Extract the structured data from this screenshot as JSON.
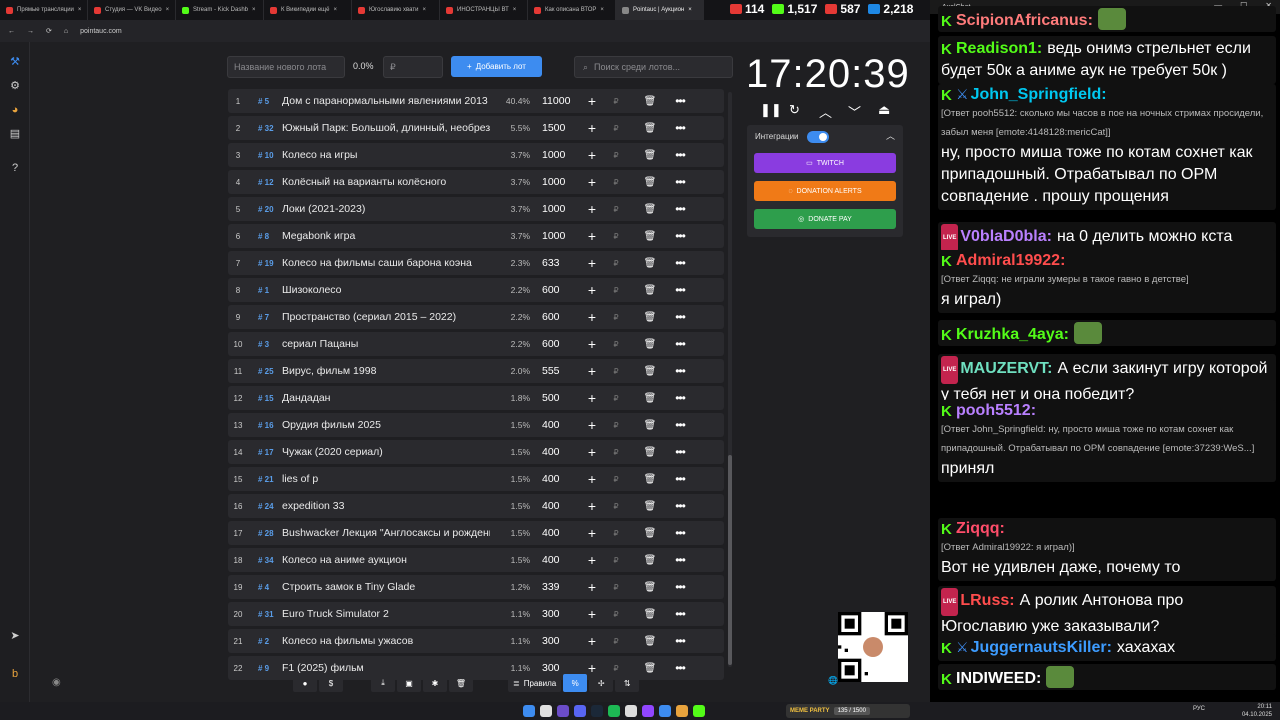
{
  "browser": {
    "tabs": [
      {
        "label": "Прямые трансляции",
        "color": "#e53935"
      },
      {
        "label": "Студия — VK Видео",
        "color": "#e53935"
      },
      {
        "label": "Stream - Kick Dashb",
        "color": "#53fc18"
      },
      {
        "label": "К Википедии ещё",
        "color": "#e53935"
      },
      {
        "label": "Югославию хвати",
        "color": "#e53935"
      },
      {
        "label": "ИНОСТРАНЦЫ ВТ",
        "color": "#e53935"
      },
      {
        "label": "Как описана ВТОР",
        "color": "#e53935"
      },
      {
        "label": "Pointauc | Аукцион",
        "color": "#888888",
        "active": true
      }
    ],
    "url": "pointauc.com"
  },
  "stream_stats": [
    {
      "value": "114",
      "color": "#e53935"
    },
    {
      "value": "1,517",
      "color": "#53fc18"
    },
    {
      "value": "587",
      "color": "#e53935"
    },
    {
      "value": "2,218",
      "color": "#1e88e5"
    }
  ],
  "controls": {
    "lot_name_placeholder": "Название нового лота",
    "percent": "0.0%",
    "amount_placeholder": "₽",
    "add_button": "Добавить лот",
    "search_placeholder": "Поиск среди лотов..."
  },
  "lots": [
    {
      "idx": "1",
      "id": "# 5",
      "name": "Дом с паранормальными явлениями 2013",
      "pct": "40.4%",
      "amount": "11000"
    },
    {
      "idx": "2",
      "id": "# 32",
      "name": "Южный Парк: Большой, длинный, необрезанный",
      "pct": "5.5%",
      "amount": "1500"
    },
    {
      "idx": "3",
      "id": "# 10",
      "name": "Колесо на игры",
      "pct": "3.7%",
      "amount": "1000"
    },
    {
      "idx": "4",
      "id": "# 12",
      "name": "Колёсный на варианты колёсного",
      "pct": "3.7%",
      "amount": "1000"
    },
    {
      "idx": "5",
      "id": "# 20",
      "name": "Локи (2021-2023)",
      "pct": "3.7%",
      "amount": "1000"
    },
    {
      "idx": "6",
      "id": "# 8",
      "name": "Megabonk игра",
      "pct": "3.7%",
      "amount": "1000"
    },
    {
      "idx": "7",
      "id": "# 19",
      "name": "Колесо на фильмы саши барона коэна",
      "pct": "2.3%",
      "amount": "633"
    },
    {
      "idx": "8",
      "id": "# 1",
      "name": "Шизоколесо",
      "pct": "2.2%",
      "amount": "600"
    },
    {
      "idx": "9",
      "id": "# 7",
      "name": "Пространство (сериал 2015 – 2022)",
      "pct": "2.2%",
      "amount": "600"
    },
    {
      "idx": "10",
      "id": "# 3",
      "name": "сериал Пацаны",
      "pct": "2.2%",
      "amount": "600"
    },
    {
      "idx": "11",
      "id": "# 25",
      "name": "Вирус, фильм 1998",
      "pct": "2.0%",
      "amount": "555"
    },
    {
      "idx": "12",
      "id": "# 15",
      "name": "Дандадан",
      "pct": "1.8%",
      "amount": "500"
    },
    {
      "idx": "13",
      "id": "# 16",
      "name": "Орудия фильм 2025",
      "pct": "1.5%",
      "amount": "400"
    },
    {
      "idx": "14",
      "id": "# 17",
      "name": "Чужак (2020 сериал)",
      "pct": "1.5%",
      "amount": "400"
    },
    {
      "idx": "15",
      "id": "# 21",
      "name": "lies of p",
      "pct": "1.5%",
      "amount": "400"
    },
    {
      "idx": "16",
      "id": "# 24",
      "name": "expedition 33",
      "pct": "1.5%",
      "amount": "400"
    },
    {
      "idx": "17",
      "id": "# 28",
      "name": "Bushwacker Лекция \"Англосаксы и рождение",
      "pct": "1.5%",
      "amount": "400"
    },
    {
      "idx": "18",
      "id": "# 34",
      "name": "Колесо на аниме аукцион",
      "pct": "1.5%",
      "amount": "400"
    },
    {
      "idx": "19",
      "id": "# 4",
      "name": "Строить замок в Tiny Glade",
      "pct": "1.2%",
      "amount": "339"
    },
    {
      "idx": "20",
      "id": "# 31",
      "name": "Euro Truck Simulator 2",
      "pct": "1.1%",
      "amount": "300"
    },
    {
      "idx": "21",
      "id": "# 2",
      "name": "Колесо на фильмы ужасов",
      "pct": "1.1%",
      "amount": "300"
    },
    {
      "idx": "22",
      "id": "# 9",
      "name": "F1 (2025) фильм",
      "pct": "1.1%",
      "amount": "300"
    }
  ],
  "timer": "17:20:39",
  "integrations": {
    "label": "Интеграции",
    "twitch": "TWITCH",
    "donation_alerts": "DONATION ALERTS",
    "donate_pay": "DONATE PAY"
  },
  "bottom": {
    "rules": "Правила",
    "percent": "%"
  },
  "chat": {
    "title": "AxelChat",
    "messages": [
      {
        "badge": "k",
        "user": "ScipionAfricanus:",
        "color": "#ff7b7b",
        "text": ""
      },
      {
        "badge": "k",
        "user": "Readison1:",
        "color": "#53fc18",
        "text": "ведь онимэ стрельнет если будет 50к а аниме аук не требует 50к )"
      },
      {
        "badge": "k",
        "pick": true,
        "user": "John_Springfield:",
        "color": "#00c8f0",
        "reply": "[Ответ pooh5512: сколько мы часов в пое на ночных стримах просидели, забыл меня [emote:4148128:mericCat]]",
        "text": "ну, просто миша тоже по котам сохнет как припадошный. Отрабатывал по ОРМ совпадение . прошу прощения"
      },
      {
        "badge": "live",
        "user": "V0blaD0bla:",
        "color": "#b980ff",
        "text": "на 0 делить можно кста"
      },
      {
        "badge": "k",
        "user": "Admiral19922:",
        "color": "#ff4d4d",
        "reply": "[Ответ Ziqqq: не играли зумеры в такое гавно в детстве]",
        "text": "я играл)"
      },
      {
        "badge": "k",
        "user": "Kruzhka_4aya:",
        "color": "#53fc18",
        "text": ""
      },
      {
        "badge": "live",
        "user": "MAUZERVT:",
        "color": "#6fe0c0",
        "text": "А если закинут игру которой у тебя нет и она победит?"
      },
      {
        "badge": "k",
        "user": "pooh5512:",
        "color": "#b980ff",
        "reply": "[Ответ John_Springfield: ну, просто миша тоже по котам сохнет как припадошный. Отрабатывал по ОРМ совпадение [emote:37239:WeS...]",
        "text": "принял"
      },
      {
        "badge": "k",
        "user": "Ziqqq:",
        "color": "#ff4d6a",
        "reply": "[Ответ Admiral19922: я играл)]",
        "text": "Вот не удивлен даже, почему то"
      },
      {
        "badge": "live",
        "user": "LRuss:",
        "color": "#ff4d4d",
        "text": "А ролик Антонова про Югославию уже заказывали?"
      },
      {
        "badge": "k",
        "pick": true,
        "user": "JuggernautsKiller:",
        "color": "#3d9cff",
        "text": "хахахах"
      },
      {
        "badge": "k",
        "user": "INDIWEED:",
        "color": "#ffffff",
        "text": ""
      }
    ]
  },
  "taskbar": {
    "lang": "РУС",
    "time": "20:11",
    "date": "04.10.2025",
    "meme_party": "MEME PARTY",
    "progress": "135 / 1500"
  }
}
